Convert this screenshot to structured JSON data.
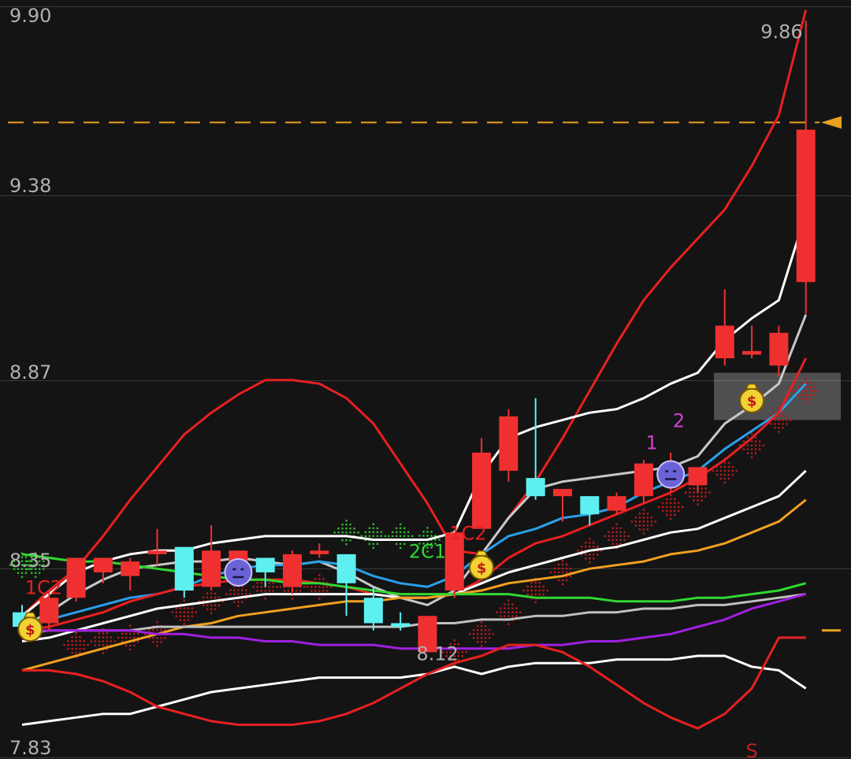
{
  "chart_data": {
    "type": "candlestick",
    "y_axis": {
      "ticks": [
        "9.90",
        "9.38",
        "8.87",
        "8.35",
        "7.83"
      ],
      "ylim": [
        7.83,
        9.9
      ]
    },
    "grid": true,
    "candles": [
      {
        "o": 8.23,
        "h": 8.25,
        "l": 8.18,
        "c": 8.19
      },
      {
        "o": 8.2,
        "h": 8.29,
        "l": 8.18,
        "c": 8.27
      },
      {
        "o": 8.27,
        "h": 8.38,
        "l": 8.26,
        "c": 8.38
      },
      {
        "o": 8.34,
        "h": 8.38,
        "l": 8.31,
        "c": 8.38
      },
      {
        "o": 8.33,
        "h": 8.38,
        "l": 8.29,
        "c": 8.37
      },
      {
        "o": 8.39,
        "h": 8.46,
        "l": 8.36,
        "c": 8.4
      },
      {
        "o": 8.41,
        "h": 8.41,
        "l": 8.27,
        "c": 8.29
      },
      {
        "o": 8.3,
        "h": 8.47,
        "l": 8.29,
        "c": 8.4
      },
      {
        "o": 8.37,
        "h": 8.4,
        "l": 8.3,
        "c": 8.4
      },
      {
        "o": 8.38,
        "h": 8.38,
        "l": 8.3,
        "c": 8.34
      },
      {
        "o": 8.3,
        "h": 8.4,
        "l": 8.28,
        "c": 8.39
      },
      {
        "o": 8.39,
        "h": 8.42,
        "l": 8.38,
        "c": 8.4
      },
      {
        "o": 8.39,
        "h": 8.39,
        "l": 8.22,
        "c": 8.31
      },
      {
        "o": 8.27,
        "h": 8.3,
        "l": 8.18,
        "c": 8.2
      },
      {
        "o": 8.2,
        "h": 8.23,
        "l": 8.18,
        "c": 8.19
      },
      {
        "o": 8.12,
        "h": 8.22,
        "l": 8.12,
        "c": 8.22
      },
      {
        "o": 8.29,
        "h": 8.45,
        "l": 8.27,
        "c": 8.45
      },
      {
        "o": 8.46,
        "h": 8.71,
        "l": 8.46,
        "c": 8.67
      },
      {
        "o": 8.62,
        "h": 8.79,
        "l": 8.59,
        "c": 8.77
      },
      {
        "o": 8.6,
        "h": 8.82,
        "l": 8.54,
        "c": 8.55
      },
      {
        "o": 8.55,
        "h": 8.57,
        "l": 8.48,
        "c": 8.57
      },
      {
        "o": 8.55,
        "h": 8.55,
        "l": 8.47,
        "c": 8.5
      },
      {
        "o": 8.51,
        "h": 8.56,
        "l": 8.5,
        "c": 8.55
      },
      {
        "o": 8.55,
        "h": 8.65,
        "l": 8.53,
        "c": 8.64
      },
      {
        "o": 8.6,
        "h": 8.67,
        "l": 8.56,
        "c": 8.64
      },
      {
        "o": 8.58,
        "h": 8.63,
        "l": 8.56,
        "c": 8.63
      },
      {
        "o": 8.93,
        "h": 9.12,
        "l": 8.91,
        "c": 9.02
      },
      {
        "o": 8.94,
        "h": 9.02,
        "l": 8.93,
        "c": 8.95
      },
      {
        "o": 8.91,
        "h": 9.02,
        "l": 8.88,
        "c": 9.0
      },
      {
        "o": 9.14,
        "h": 9.86,
        "l": 9.05,
        "c": 9.56
      }
    ],
    "lines": [
      {
        "color": "#e82020",
        "values": [
          8.22,
          8.29,
          8.35,
          8.44,
          8.54,
          8.63,
          8.72,
          8.78,
          8.83,
          8.87,
          8.87,
          8.86,
          8.82,
          8.75,
          8.64,
          8.53,
          8.4,
          8.39,
          8.49,
          8.59,
          8.71,
          8.84,
          8.97,
          9.09,
          9.18,
          9.26,
          9.34,
          9.46,
          9.6,
          9.89
        ]
      },
      {
        "color": "#ffffff",
        "values": [
          8.22,
          8.28,
          8.34,
          8.37,
          8.39,
          8.4,
          8.4,
          8.42,
          8.43,
          8.44,
          8.44,
          8.44,
          8.44,
          8.43,
          8.43,
          8.43,
          8.45,
          8.61,
          8.71,
          8.74,
          8.76,
          8.78,
          8.79,
          8.82,
          8.86,
          8.89,
          8.98,
          9.04,
          9.09,
          9.33
        ]
      },
      {
        "color": "#c8c8c8",
        "values": [
          8.19,
          8.23,
          8.28,
          8.32,
          8.35,
          8.36,
          8.37,
          8.37,
          8.38,
          8.37,
          8.36,
          8.37,
          8.34,
          8.3,
          8.27,
          8.25,
          8.29,
          8.39,
          8.49,
          8.57,
          8.59,
          8.6,
          8.61,
          8.62,
          8.63,
          8.66,
          8.75,
          8.8,
          8.86,
          9.05
        ]
      },
      {
        "color": "#2aa0e8",
        "values": [
          8.2,
          8.21,
          8.23,
          8.25,
          8.27,
          8.28,
          8.3,
          8.33,
          8.35,
          8.36,
          8.36,
          8.37,
          8.36,
          8.33,
          8.31,
          8.3,
          8.33,
          8.39,
          8.44,
          8.46,
          8.49,
          8.5,
          8.52,
          8.56,
          8.59,
          8.62,
          8.68,
          8.73,
          8.78,
          8.86
        ]
      },
      {
        "color": "#e82020",
        "values": [
          8.18,
          8.19,
          8.21,
          8.23,
          8.26,
          8.28,
          8.3,
          8.31,
          8.32,
          8.32,
          8.32,
          8.31,
          8.3,
          8.28,
          8.27,
          8.27,
          8.28,
          8.32,
          8.38,
          8.42,
          8.44,
          8.47,
          8.5,
          8.53,
          8.56,
          8.6,
          8.65,
          8.71,
          8.78,
          8.93
        ]
      },
      {
        "color": "#ffffff",
        "values": [
          8.15,
          8.16,
          8.18,
          8.2,
          8.22,
          8.24,
          8.25,
          8.26,
          8.27,
          8.28,
          8.28,
          8.28,
          8.28,
          8.28,
          8.27,
          8.27,
          8.28,
          8.31,
          8.34,
          8.36,
          8.38,
          8.4,
          8.41,
          8.43,
          8.45,
          8.46,
          8.49,
          8.52,
          8.55,
          8.62
        ]
      },
      {
        "color": "#f0a020",
        "values": [
          8.07,
          8.09,
          8.11,
          8.13,
          8.15,
          8.17,
          8.19,
          8.2,
          8.22,
          8.23,
          8.24,
          8.25,
          8.26,
          8.26,
          8.27,
          8.27,
          8.28,
          8.29,
          8.31,
          8.32,
          8.33,
          8.35,
          8.36,
          8.37,
          8.39,
          8.4,
          8.42,
          8.45,
          8.48,
          8.54
        ]
      },
      {
        "color": "#30d830",
        "values": [
          8.39,
          8.38,
          8.37,
          8.37,
          8.36,
          8.35,
          8.34,
          8.33,
          8.32,
          8.32,
          8.31,
          8.31,
          8.3,
          8.29,
          8.28,
          8.28,
          8.28,
          8.28,
          8.28,
          8.27,
          8.27,
          8.27,
          8.26,
          8.26,
          8.26,
          8.27,
          8.27,
          8.28,
          8.29,
          8.31
        ]
      },
      {
        "color": "#c0c0c0",
        "values": [
          8.17,
          8.18,
          8.18,
          8.18,
          8.18,
          8.19,
          8.19,
          8.19,
          8.19,
          8.19,
          8.19,
          8.19,
          8.19,
          8.19,
          8.19,
          8.2,
          8.2,
          8.21,
          8.21,
          8.22,
          8.22,
          8.23,
          8.23,
          8.24,
          8.24,
          8.25,
          8.25,
          8.26,
          8.27,
          8.28
        ]
      },
      {
        "color": "#a020e0",
        "values": [
          8.18,
          8.18,
          8.18,
          8.18,
          8.18,
          8.17,
          8.17,
          8.16,
          8.16,
          8.15,
          8.15,
          8.14,
          8.14,
          8.14,
          8.13,
          8.13,
          8.13,
          8.13,
          8.13,
          8.14,
          8.14,
          8.15,
          8.15,
          8.16,
          8.17,
          8.19,
          8.21,
          8.24,
          8.26,
          8.28
        ]
      },
      {
        "color": "#ffffff",
        "values": [
          7.92,
          7.93,
          7.94,
          7.95,
          7.95,
          7.97,
          7.99,
          8.01,
          8.02,
          8.03,
          8.04,
          8.05,
          8.05,
          8.05,
          8.05,
          8.06,
          8.08,
          8.06,
          8.08,
          8.09,
          8.09,
          8.09,
          8.1,
          8.1,
          8.1,
          8.11,
          8.11,
          8.08,
          8.07,
          8.02
        ]
      },
      {
        "color": "#e82020",
        "values": [
          8.07,
          8.07,
          8.06,
          8.04,
          8.01,
          7.97,
          7.95,
          7.93,
          7.92,
          7.92,
          7.92,
          7.93,
          7.95,
          7.98,
          8.02,
          8.06,
          8.09,
          8.11,
          8.14,
          8.14,
          8.12,
          8.08,
          8.03,
          7.98,
          7.94,
          7.91,
          7.95,
          8.02,
          8.16,
          8.16
        ]
      }
    ],
    "dots_green": [
      {
        "i": 0,
        "v": 8.36
      },
      {
        "i": 0.5,
        "v": 8.36
      },
      {
        "i": 12,
        "v": 8.45
      },
      {
        "i": 13,
        "v": 8.44
      },
      {
        "i": 14,
        "v": 8.44
      },
      {
        "i": 15,
        "v": 8.43
      }
    ],
    "dots_red": [
      {
        "i": 2,
        "v": 8.14
      },
      {
        "i": 3,
        "v": 8.15
      },
      {
        "i": 4,
        "v": 8.16
      },
      {
        "i": 5,
        "v": 8.17
      },
      {
        "i": 6,
        "v": 8.23
      },
      {
        "i": 7,
        "v": 8.26
      },
      {
        "i": 8,
        "v": 8.28
      },
      {
        "i": 9,
        "v": 8.3
      },
      {
        "i": 10,
        "v": 8.3
      },
      {
        "i": 11,
        "v": 8.3
      },
      {
        "i": 16,
        "v": 8.12
      },
      {
        "i": 17,
        "v": 8.17
      },
      {
        "i": 18,
        "v": 8.23
      },
      {
        "i": 19,
        "v": 8.29
      },
      {
        "i": 20,
        "v": 8.34
      },
      {
        "i": 21,
        "v": 8.4
      },
      {
        "i": 22,
        "v": 8.44
      },
      {
        "i": 23,
        "v": 8.48
      },
      {
        "i": 24,
        "v": 8.52
      },
      {
        "i": 25,
        "v": 8.56
      },
      {
        "i": 26,
        "v": 8.62
      },
      {
        "i": 27,
        "v": 8.69
      },
      {
        "i": 28,
        "v": 8.76
      },
      {
        "i": 29,
        "v": 8.84
      }
    ],
    "resistance_level": 9.58,
    "reference_tick": 8.18,
    "highlight_zone": {
      "from_index": 25.6,
      "to_index": 30,
      "low": 8.76,
      "high": 8.89
    },
    "labels": {
      "max": {
        "text": "9.86",
        "i": 29,
        "v": 9.86
      },
      "min": {
        "text": "8.12",
        "i": 15,
        "v": 8.12
      },
      "ann": [
        {
          "text": "1C2",
          "i": 0.8,
          "v": 8.28,
          "color": "#e82020"
        },
        {
          "text": "2C1",
          "i": 15,
          "v": 8.38,
          "color": "#30d830"
        },
        {
          "text": "1C2",
          "i": 16.5,
          "v": 8.43,
          "color": "#e82020"
        },
        {
          "text": "1",
          "i": 23.3,
          "v": 8.68,
          "color": "#d040d0"
        },
        {
          "text": "2",
          "i": 24.3,
          "v": 8.74,
          "color": "#d040d0"
        },
        {
          "text": "S",
          "i": 27,
          "v": 7.83,
          "color": "#c02020"
        }
      ]
    },
    "icons": [
      {
        "kind": "money-bag",
        "i": 0.3,
        "v": 8.19
      },
      {
        "kind": "money-bag",
        "i": 17,
        "v": 8.36
      },
      {
        "kind": "money-bag",
        "i": 27,
        "v": 8.82
      },
      {
        "kind": "sad-face",
        "i": 8,
        "v": 8.34
      },
      {
        "kind": "sad-face",
        "i": 24,
        "v": 8.61
      }
    ],
    "colors": {
      "up": "#f03030",
      "down": "#5ef0f0",
      "grid": "#3a3a3a",
      "dash": "#e8a020"
    }
  }
}
